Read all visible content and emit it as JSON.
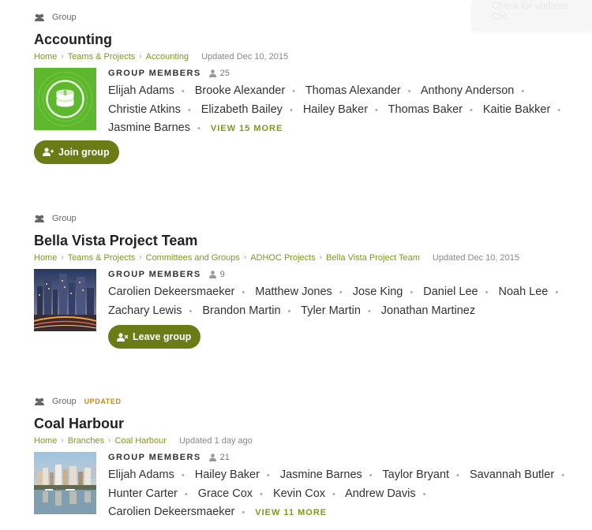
{
  "toast": {
    "line1": "Check for updates",
    "line2": "Ctrl"
  },
  "groups": [
    {
      "type_label": "Group",
      "badge": "",
      "title": "Accounting",
      "breadcrumbs": [
        "Home",
        "Teams & Projects",
        "Accounting"
      ],
      "updated": "Updated Dec 10, 2015",
      "members_label": "GROUP MEMBERS",
      "member_count": "25",
      "members": [
        "Elijah Adams",
        "Brooke Alexander",
        "Thomas Alexander",
        "Anthony Anderson",
        "Christie Atkins",
        "Elizabeth Bailey",
        "Hailey Baker",
        "Thomas Baker",
        "Kaitie Bakker",
        "Jasmine Barnes"
      ],
      "view_more": "VIEW 15 MORE",
      "action": "Join group",
      "thumbnail_icon": "money-stack-icon"
    },
    {
      "type_label": "Group",
      "badge": "",
      "title": "Bella Vista Project Team",
      "breadcrumbs": [
        "Home",
        "Teams & Projects",
        "Committees and Groups",
        "ADHOC Projects",
        "Bella Vista Project Team"
      ],
      "updated": "Updated Dec 10, 2015",
      "members_label": "GROUP MEMBERS",
      "member_count": "9",
      "members": [
        "Carolien Dekeersmaeker",
        "Matthew Jones",
        "Jose King",
        "Daniel Lee",
        "Noah Lee",
        "Zachary Lewis",
        "Brandon Martin",
        "Tyler Martin",
        "Jonathan Martinez"
      ],
      "view_more": "",
      "action": "Leave group",
      "thumbnail_icon": "city-night-photo"
    },
    {
      "type_label": "Group",
      "badge": "UPDATED",
      "title": "Coal Harbour",
      "breadcrumbs": [
        "Home",
        "Branches",
        "Coal Harbour"
      ],
      "updated": "Updated 1 day ago",
      "members_label": "GROUP MEMBERS",
      "member_count": "21",
      "members": [
        "Elijah Adams",
        "Hailey Baker",
        "Jasmine Barnes",
        "Taylor Bryant",
        "Savannah Butler",
        "Hunter Carter",
        "Grace Cox",
        "Kevin Cox",
        "Andrew Davis",
        "Carolien Dekeersmaeker"
      ],
      "view_more": "VIEW 11 MORE",
      "action": "",
      "thumbnail_icon": "harbour-photo"
    }
  ]
}
